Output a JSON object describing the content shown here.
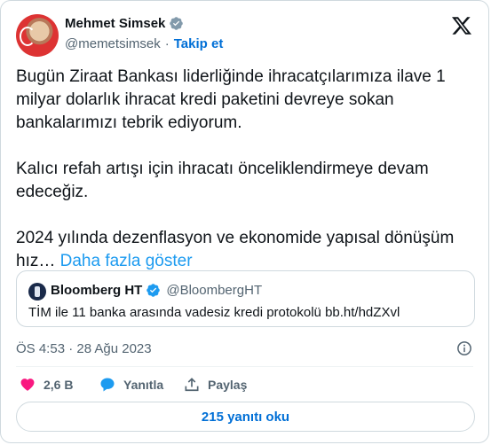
{
  "author": {
    "name": "Mehmet Simsek",
    "handle": "@memetsimsek",
    "follow_label": "Takip et"
  },
  "tweet": {
    "text": "Bugün Ziraat Bankası liderliğinde ihracatçılarımıza ilave 1 milyar dolarlık ihracat kredi paketini devreye sokan bankalarımızı tebrik ediyorum.\n\nKalıcı refah artışı için ihracatı önceliklendirmeye devam edeceğiz.\n\n2024 yılında dezenflasyon ve ekonomide yapısal dönüşüm hız… ",
    "show_more": "Daha fazla göster"
  },
  "quote": {
    "name": "Bloomberg HT",
    "handle": "@BloombergHT",
    "text": "TİM ile 11 banka arasında vadesiz kredi protokolü bb.ht/hdZXvl"
  },
  "timestamp": "ÖS 4:53 · 28 Ağu 2023",
  "actions": {
    "likes": "2,6 B",
    "reply_label": "Yanıtla",
    "share_label": "Paylaş"
  },
  "replies_button": "215 yanıtı oku",
  "colors": {
    "accent": "#1d9bf0",
    "like": "#f91880",
    "verified": "#1d9bf0"
  }
}
